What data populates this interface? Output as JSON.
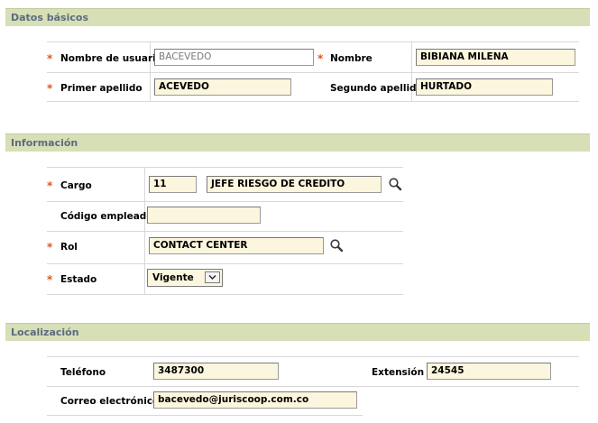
{
  "sections": {
    "basic": {
      "title": "Datos básicos"
    },
    "info": {
      "title": "Información"
    },
    "location": {
      "title": "Localización"
    }
  },
  "basic": {
    "username_label": "Nombre de usuario",
    "username_value": "BACEVEDO",
    "name_label": "Nombre",
    "name_value": "BIBIANA MILENA",
    "first_surname_label": "Primer apellido",
    "first_surname_value": "ACEVEDO",
    "second_surname_label": "Segundo apellido",
    "second_surname_value": "HURTADO"
  },
  "info": {
    "cargo_label": "Cargo",
    "cargo_code": "11",
    "cargo_name": "JEFE RIESGO DE CREDITO",
    "employee_code_label": "Código empleado",
    "employee_code_value": "",
    "rol_label": "Rol",
    "rol_value": "CONTACT CENTER",
    "estado_label": "Estado",
    "estado_value": "Vigente"
  },
  "location": {
    "phone_label": "Teléfono",
    "phone_value": "3487300",
    "extension_label": "Extensión",
    "extension_value": "24545",
    "email_label": "Correo electrónico",
    "email_value": "bacevedo@juriscoop.com.co"
  },
  "required_marker": "*",
  "colors": {
    "section_bar": "#d6dfb6",
    "section_title": "#5d6a80",
    "required": "#e2541a",
    "field_bg": "#fdf6de"
  },
  "icons": {
    "lookup": "magnifier-icon",
    "dropdown": "chevron-down-icon"
  }
}
